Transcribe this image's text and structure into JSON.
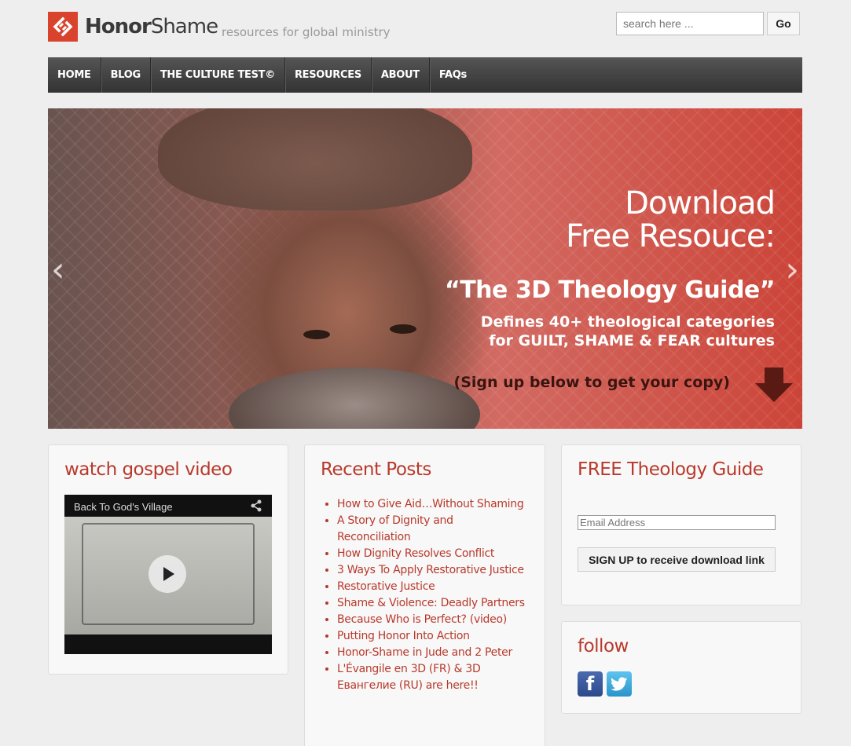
{
  "header": {
    "logo_text_bold": "Honor",
    "logo_text_light": "Shame",
    "tagline": "resources for global ministry",
    "search_placeholder": "search here ...",
    "search_button": "Go"
  },
  "nav": {
    "items": [
      "HOME",
      "BLOG",
      "THE CULTURE TEST©",
      "RESOURCES",
      "ABOUT",
      "FAQs"
    ]
  },
  "hero": {
    "line1": "Download",
    "line2": "Free Resouce:",
    "guide": "“The 3D Theology Guide”",
    "defines1": "Defines 40+ theological categories",
    "defines2": "for GUILT, SHAME & FEAR cultures",
    "signup": "(Sign up below to get your copy)"
  },
  "video_widget": {
    "title": "watch gospel video",
    "video_title": "Back To God's Village"
  },
  "posts_widget": {
    "title": "Recent Posts",
    "posts": [
      "How to Give Aid…Without Shaming",
      "A Story of Dignity and Reconciliation",
      "How Dignity Resolves Conflict",
      "3 Ways To Apply Restorative Justice",
      "Restorative Justice",
      "Shame & Violence: Deadly Partners",
      "Because Who is Perfect? (video)",
      "Putting Honor Into Action",
      "Honor-Shame in Jude and 2 Peter",
      "L'Évangile en 3D (FR) & 3D Евангелие (RU) are here!!"
    ]
  },
  "guide_widget": {
    "title": "FREE Theology Guide",
    "email_placeholder": "Email Address",
    "signup_button": "SIGN UP to receive download link"
  },
  "follow_widget": {
    "title": "follow",
    "icons": [
      "facebook-icon",
      "twitter-icon"
    ]
  },
  "colors": {
    "accent": "#b8392b",
    "logo": "#d9432e",
    "nav": "#444444"
  }
}
